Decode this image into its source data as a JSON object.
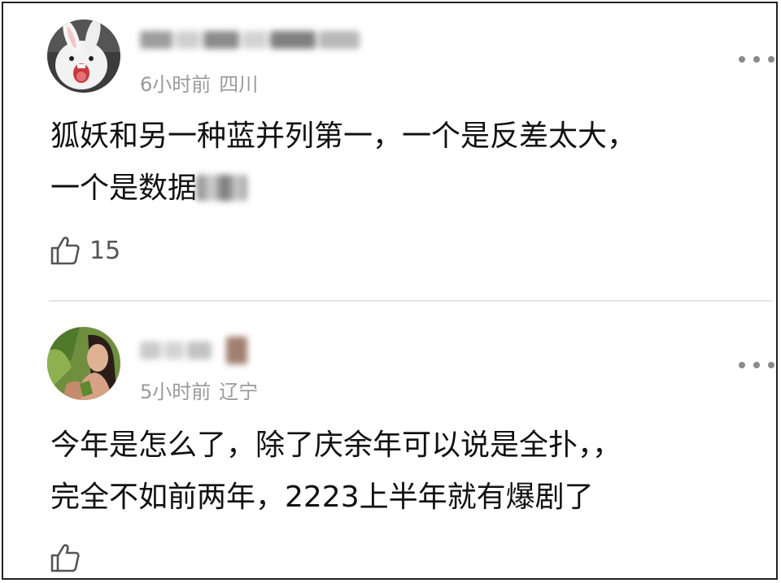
{
  "comments": [
    {
      "time": "6小时前",
      "location": "四川",
      "text_line1": "狐妖和另一种蓝并列第一，一个是反差太大，",
      "text_line2": "一个是数据",
      "likes": "15",
      "avatar_icon": "white-rabbit-avatar",
      "more_icon": "more-dots-icon",
      "like_icon": "thumbs-up-icon"
    },
    {
      "time": "5小时前",
      "location": "辽宁",
      "text_line1": "今年是怎么了，除了庆余年可以说是全扑，，",
      "text_line2": "完全不如前两年，2223上半年就有爆剧了",
      "likes": "",
      "avatar_icon": "woman-portrait-avatar",
      "more_icon": "more-dots-icon",
      "like_icon": "thumbs-up-icon"
    }
  ],
  "colors": {
    "meta": "#9a9a9a",
    "text": "#111111",
    "divider": "#e4e4e4",
    "frame": "#222222"
  }
}
